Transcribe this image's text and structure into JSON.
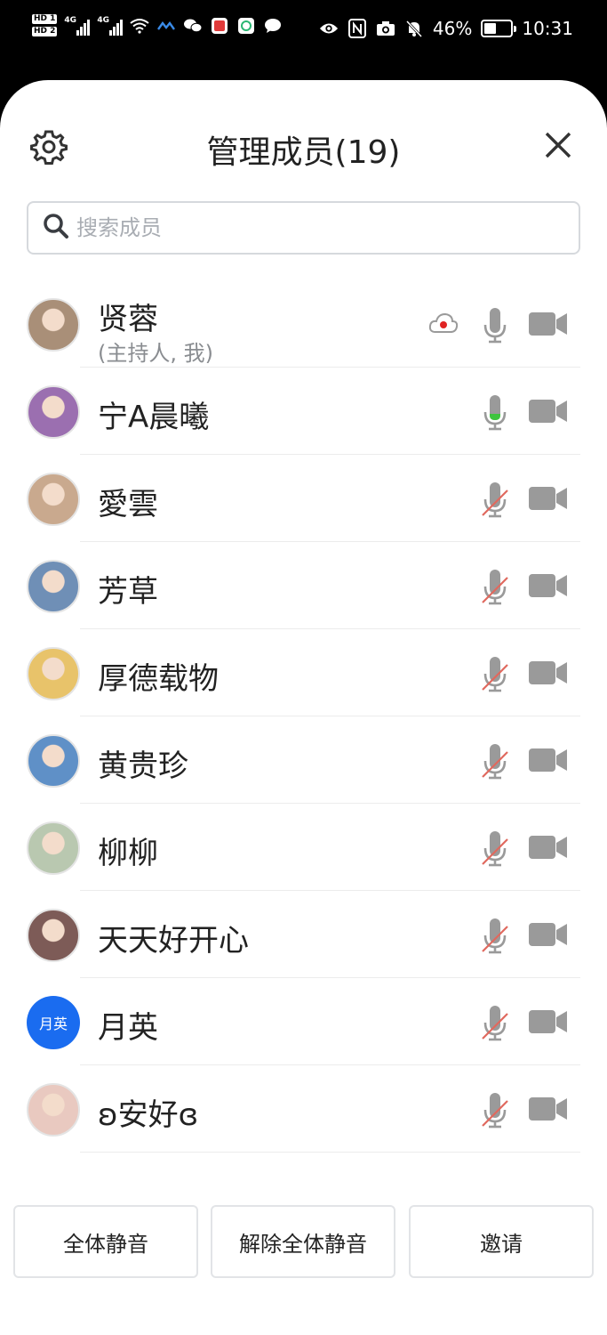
{
  "status_bar": {
    "network_1": "4G",
    "network_2": "4G",
    "battery_percent": "46%",
    "battery_level": 0.46,
    "time": "10:31"
  },
  "header": {
    "title": "管理成员(19)"
  },
  "search": {
    "placeholder": "搜索成员"
  },
  "members": [
    {
      "name": "贤蓉",
      "subtitle": "(主持人, 我)",
      "mic": "muted-gray",
      "recording": true,
      "avatar_color": "#a98f78"
    },
    {
      "name": "宁A晨曦",
      "subtitle": "",
      "mic": "active",
      "recording": false,
      "avatar_color": "#9b6fb0"
    },
    {
      "name": "愛雲",
      "subtitle": "",
      "mic": "muted",
      "recording": false,
      "avatar_color": "#c9a98e"
    },
    {
      "name": "芳草",
      "subtitle": "",
      "mic": "muted",
      "recording": false,
      "avatar_color": "#6f8fb6"
    },
    {
      "name": "厚德载物",
      "subtitle": "",
      "mic": "muted",
      "recording": false,
      "avatar_color": "#e8c36a"
    },
    {
      "name": "黄贵珍",
      "subtitle": "",
      "mic": "muted",
      "recording": false,
      "avatar_color": "#5f90c7"
    },
    {
      "name": "柳柳",
      "subtitle": "",
      "mic": "muted",
      "recording": false,
      "avatar_color": "#b9c8b0"
    },
    {
      "name": "天天好开心",
      "subtitle": "",
      "mic": "muted",
      "recording": false,
      "avatar_color": "#7d5b57"
    },
    {
      "name": "月英",
      "subtitle": "",
      "mic": "muted",
      "recording": false,
      "avatar_text": "月英",
      "avatar_color": "#1a6cf0"
    },
    {
      "name": "ʚ安好ɞ",
      "subtitle": "",
      "mic": "muted",
      "recording": false,
      "avatar_color": "#e9c9c0"
    }
  ],
  "footer": {
    "mute_all": "全体静音",
    "unmute_all": "解除全体静音",
    "invite": "邀请"
  },
  "colors": {
    "accent_blue": "#1a6cf0",
    "mic_active": "#3ec43e",
    "muted_slash": "#e0695e",
    "icon_gray": "#9a9a9a",
    "record_red": "#e02424"
  }
}
